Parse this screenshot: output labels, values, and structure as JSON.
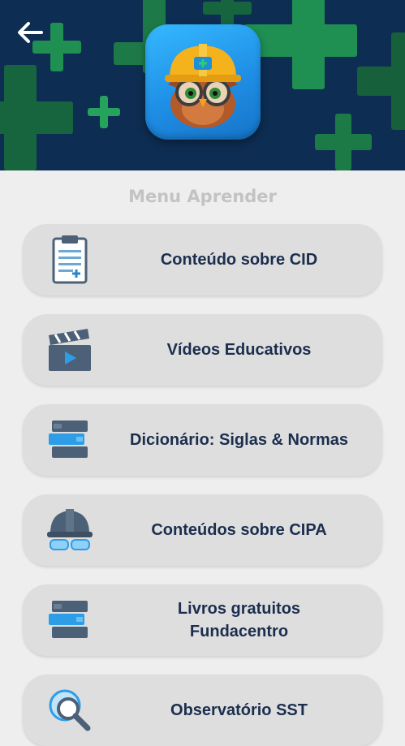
{
  "header": {
    "back_icon": "arrow-left-icon",
    "app_icon": "owl-with-hard-hat-icon",
    "background_color": "#0d2d52",
    "accent_color": "#1f9a55"
  },
  "menu": {
    "title": "Menu Aprender",
    "items": [
      {
        "label": "Conteúdo sobre CID",
        "icon": "clipboard-icon"
      },
      {
        "label": "Vídeos Educativos",
        "icon": "clapperboard-icon"
      },
      {
        "label": "Dicionário: Siglas & Normas",
        "icon": "books-stack-icon"
      },
      {
        "label": "Conteúdos sobre CIPA",
        "icon": "hard-hat-goggles-icon"
      },
      {
        "label": "Livros gratuitos\nFundacentro",
        "icon": "books-stack-icon"
      },
      {
        "label": "Observatório SST",
        "icon": "magnifier-globe-icon"
      }
    ]
  }
}
